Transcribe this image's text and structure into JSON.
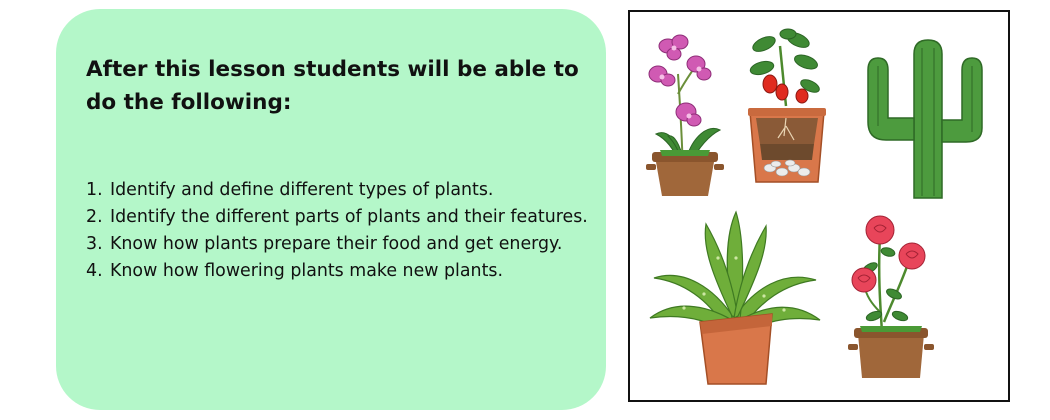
{
  "lesson": {
    "heading": "After this lesson students will be able to do the following:",
    "objectives": [
      {
        "number": "1.",
        "text": "Identify and define different types of plants."
      },
      {
        "number": "2.",
        "text": "Identify the different parts of plants and their features."
      },
      {
        "number": "3.",
        "text": "Know how plants prepare their food and get energy."
      },
      {
        "number": "4.",
        "text": "Know how flowering plants make new plants."
      }
    ]
  },
  "gallery": {
    "items": [
      {
        "icon": "orchid-pot-icon"
      },
      {
        "icon": "pepper-plant-soil-pot-icon"
      },
      {
        "icon": "cactus-icon"
      },
      {
        "icon": "aloe-pot-icon"
      },
      {
        "icon": "rose-pot-icon"
      }
    ]
  },
  "colors": {
    "panel_background": "#b4f7c9",
    "pot_brown": "#a0673a",
    "terracotta": "#d9774a",
    "leaf_green": "#3f8a34",
    "cactus_green": "#4d9b3e",
    "rose_red": "#e8455a",
    "orchid_pink": "#d05ab3"
  }
}
